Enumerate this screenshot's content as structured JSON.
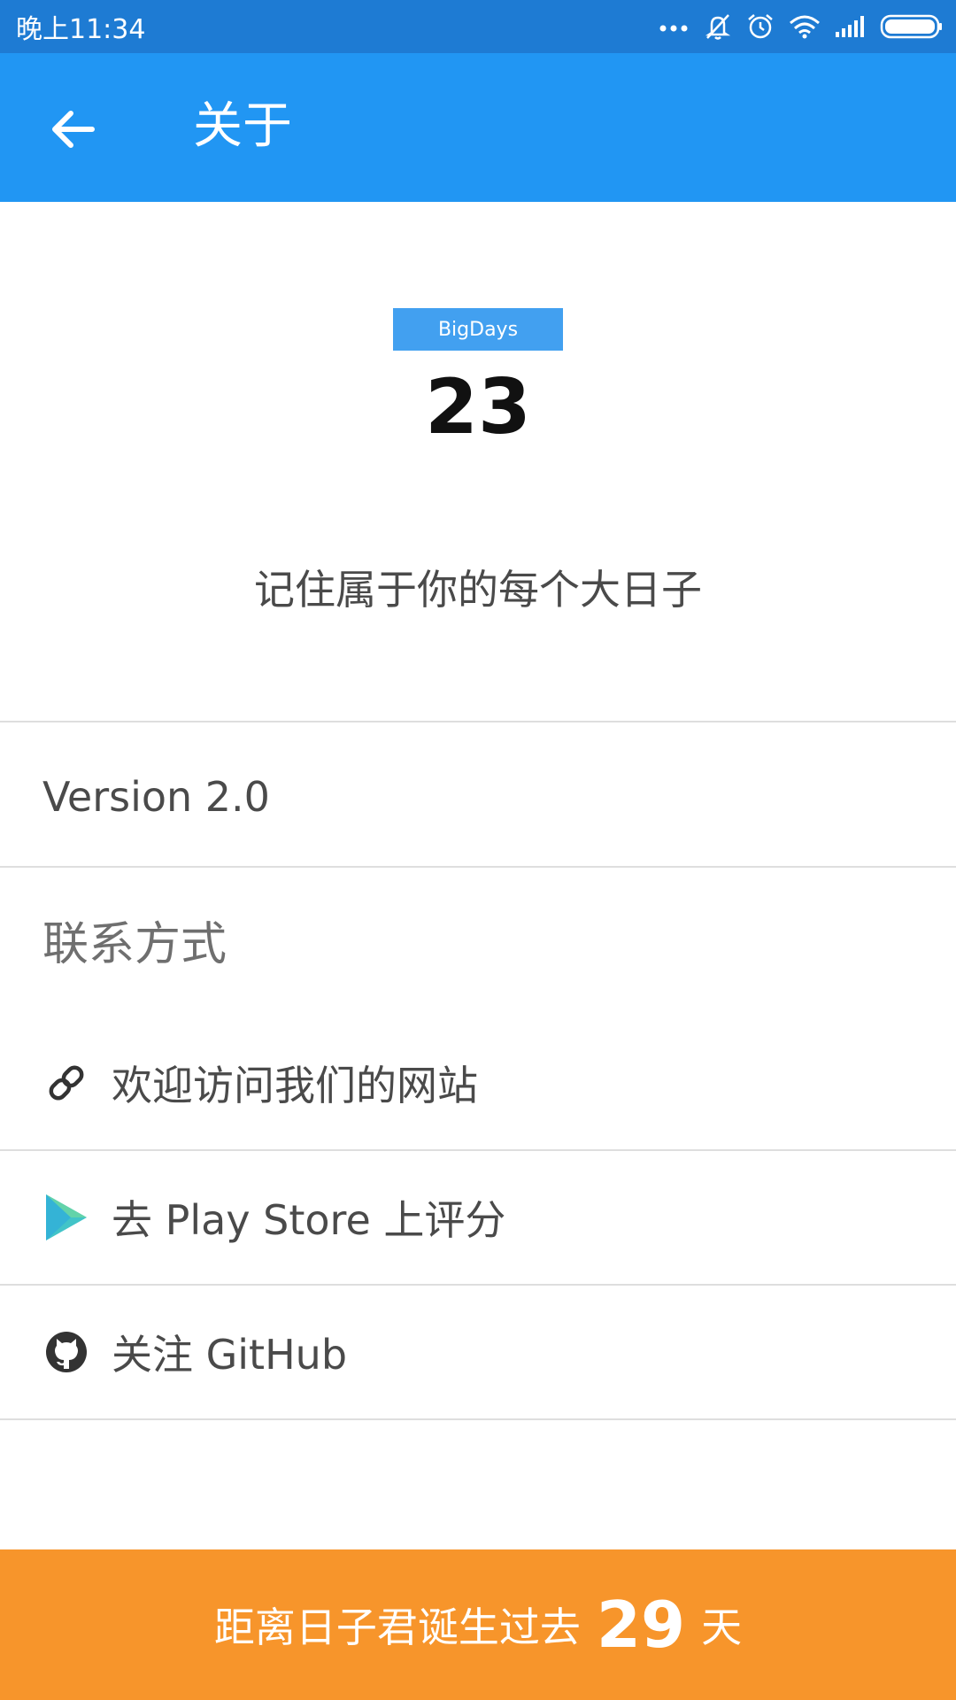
{
  "status_bar": {
    "time": "晚上11:34",
    "icons": [
      "more-dots-icon",
      "mute-icon",
      "alarm-icon",
      "wifi-icon",
      "signal-icon",
      "battery-icon"
    ]
  },
  "app_bar": {
    "title": "关于",
    "back_icon": "arrow-back-icon",
    "color": "#2196f3"
  },
  "about": {
    "logo_label": "BigDays",
    "logo_number": "23",
    "slogan": "记住属于你的每个大日子",
    "version": "Version 2.0"
  },
  "contact": {
    "title": "联系方式",
    "items": [
      {
        "label": "欢迎访问我们的网站",
        "icon": "link-icon"
      },
      {
        "label": "去 Play Store 上评分",
        "icon": "play-store-icon"
      },
      {
        "label": "关注 GitHub",
        "icon": "github-icon"
      }
    ]
  },
  "footer": {
    "prefix": "距离日子君诞生过去",
    "count": "29",
    "suffix": "天",
    "color": "#f7952b"
  }
}
